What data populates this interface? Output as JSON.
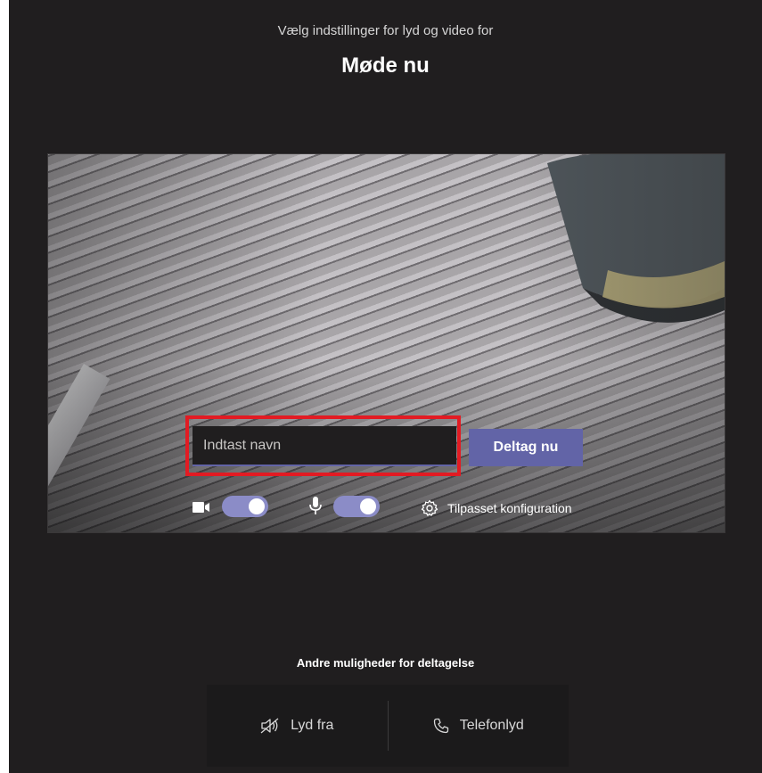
{
  "header": {
    "subtitle": "Vælg indstillinger for lyd og video for",
    "title": "Møde nu"
  },
  "join": {
    "name_placeholder": "Indtast navn",
    "name_value": "",
    "join_label": "Deltag nu"
  },
  "controls": {
    "camera_on": true,
    "mic_on": true,
    "config_label": "Tilpasset konfiguration"
  },
  "other_options": {
    "heading": "Andre muligheder for deltagelse",
    "items": [
      {
        "label": "Lyd fra",
        "icon": "speaker-off-icon"
      },
      {
        "label": "Telefonlyd",
        "icon": "phone-icon"
      }
    ]
  },
  "colors": {
    "accent": "#6264a7",
    "highlight": "#e21b23",
    "background": "#201e1f"
  }
}
